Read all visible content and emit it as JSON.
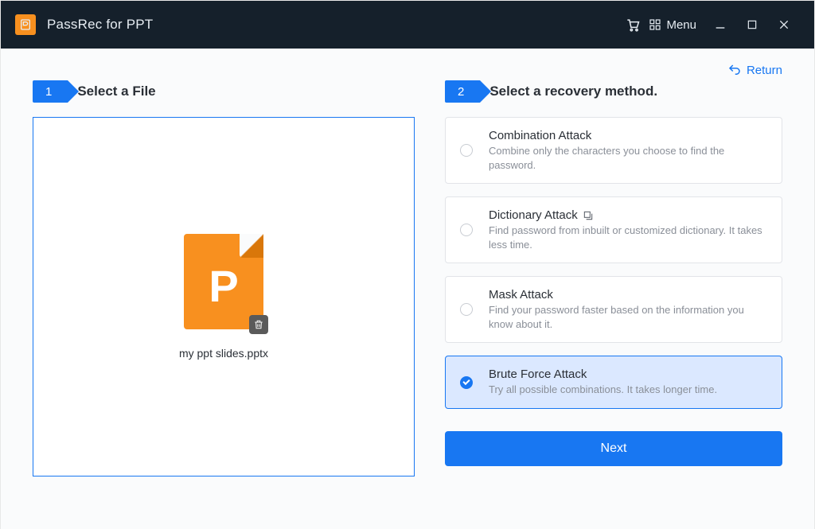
{
  "app": {
    "title": "PassRec for PPT",
    "menu_label": "Menu"
  },
  "return_label": "Return",
  "step1": {
    "num": "1",
    "title": "Select a File",
    "file_name": "my ppt slides.pptx"
  },
  "step2": {
    "num": "2",
    "title": "Select a recovery method.",
    "methods": [
      {
        "title": "Combination Attack",
        "desc": "Combine only the characters you choose to find the password.",
        "selected": false
      },
      {
        "title": "Dictionary Attack",
        "desc": "Find password from inbuilt or customized dictionary. It takes less time.",
        "selected": false,
        "has_icon": true
      },
      {
        "title": "Mask Attack",
        "desc": "Find your password faster based on the information you know about it.",
        "selected": false
      },
      {
        "title": "Brute Force Attack",
        "desc": "Try all possible combinations. It takes longer time.",
        "selected": true
      }
    ],
    "next_label": "Next"
  }
}
